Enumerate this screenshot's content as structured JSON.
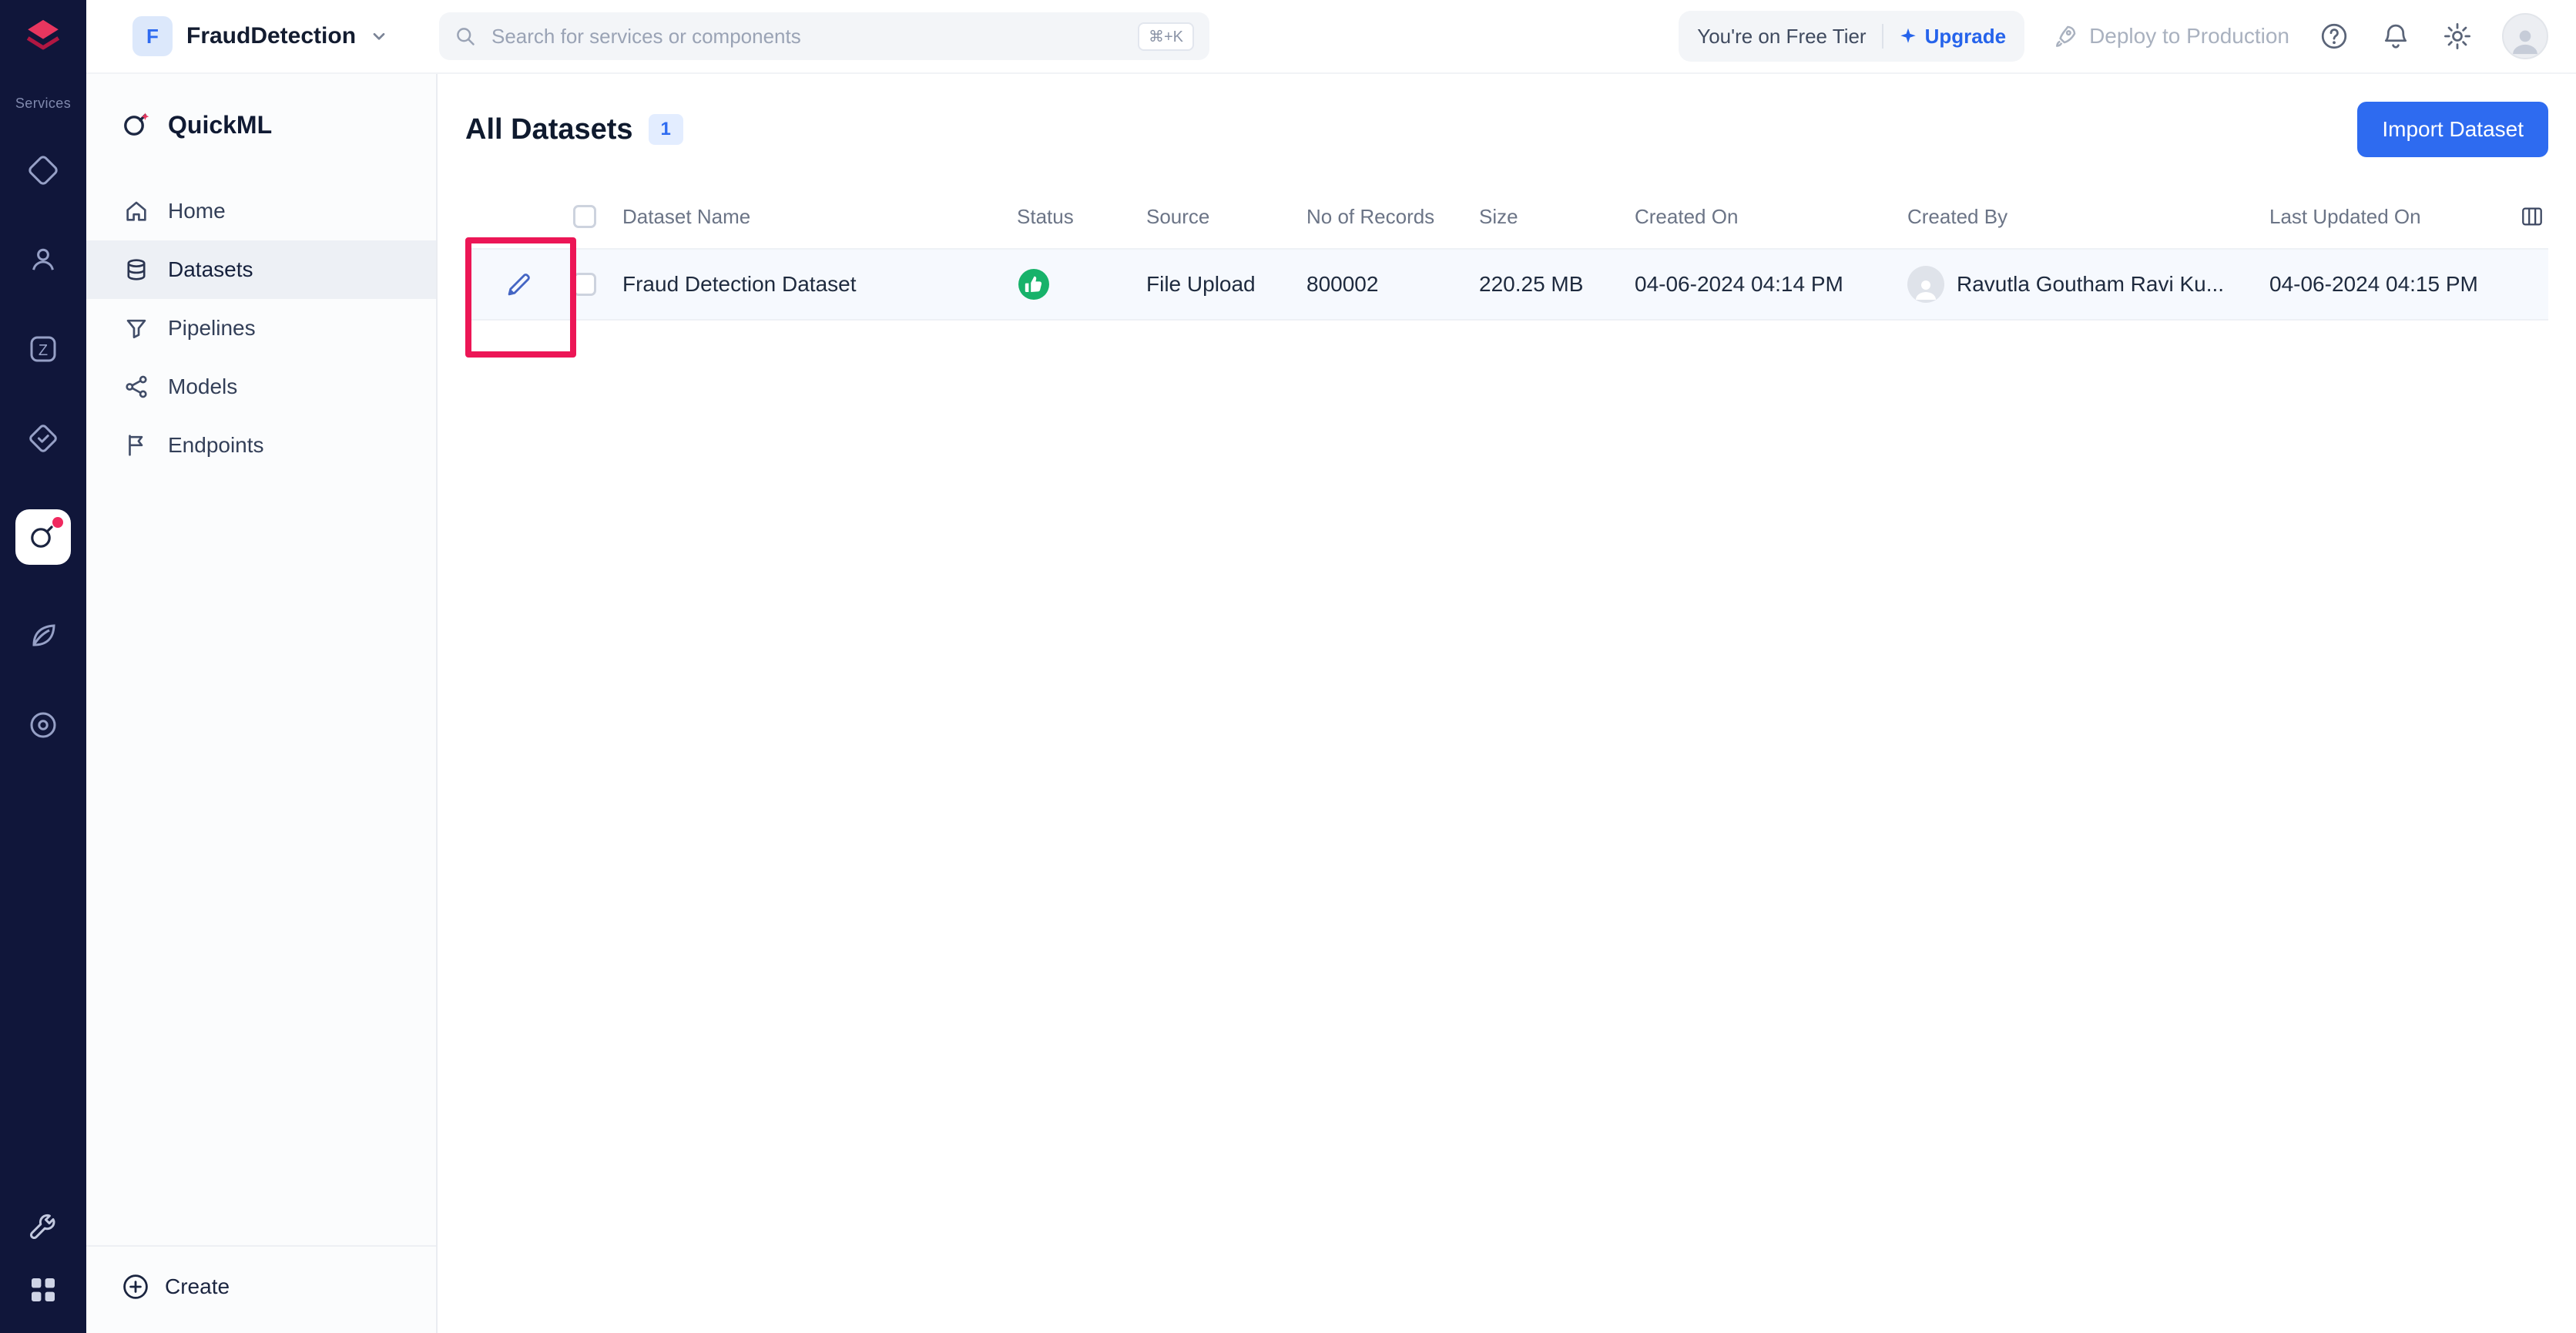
{
  "colors": {
    "accent_blue": "#2e6bf0",
    "upgrade_blue": "#2563eb",
    "status_green": "#17b26a",
    "annotation_red": "#ec1656",
    "rail_bg": "#10163a"
  },
  "icons": [
    "services-logo-icon",
    "search-icon",
    "caret-down-icon",
    "sparkle-icon",
    "rocket-icon",
    "help-icon",
    "bell-icon",
    "gear-icon",
    "user-avatar-icon",
    "quickml-logo-icon",
    "home-icon",
    "datasets-icon",
    "pipelines-icon",
    "models-icon",
    "endpoints-icon",
    "create-plus-icon",
    "edit-pencil-icon",
    "thumbs-up-status-icon",
    "row-avatar-icon",
    "column-settings-icon",
    "wrench-icon",
    "app-grid-icon"
  ],
  "rail": {
    "services_label": "Services"
  },
  "sidebar": {
    "app_name": "QuickML",
    "items": [
      {
        "label": "Home"
      },
      {
        "label": "Datasets"
      },
      {
        "label": "Pipelines"
      },
      {
        "label": "Models"
      },
      {
        "label": "Endpoints"
      }
    ],
    "create_label": "Create"
  },
  "topbar": {
    "project_initial": "F",
    "project_name": "FraudDetection",
    "search_placeholder": "Search for services or components",
    "search_shortcut": "⌘+K",
    "tier_text": "You're on Free Tier",
    "upgrade_label": "Upgrade",
    "deploy_label": "Deploy to Production"
  },
  "main": {
    "title": "All Datasets",
    "dataset_count": "1",
    "import_button_label": "Import Dataset",
    "table": {
      "columns": [
        "Dataset Name",
        "Status",
        "Source",
        "No of Records",
        "Size",
        "Created On",
        "Created By",
        "Last Updated On"
      ],
      "rows": [
        {
          "name": "Fraud Detection Dataset",
          "status": "success",
          "source": "File Upload",
          "records": "800002",
          "size": "220.25 MB",
          "created_on": "04-06-2024 04:14 PM",
          "created_by": "Ravutla Goutham Ravi Ku...",
          "last_updated_on": "04-06-2024 04:15 PM"
        }
      ]
    }
  }
}
